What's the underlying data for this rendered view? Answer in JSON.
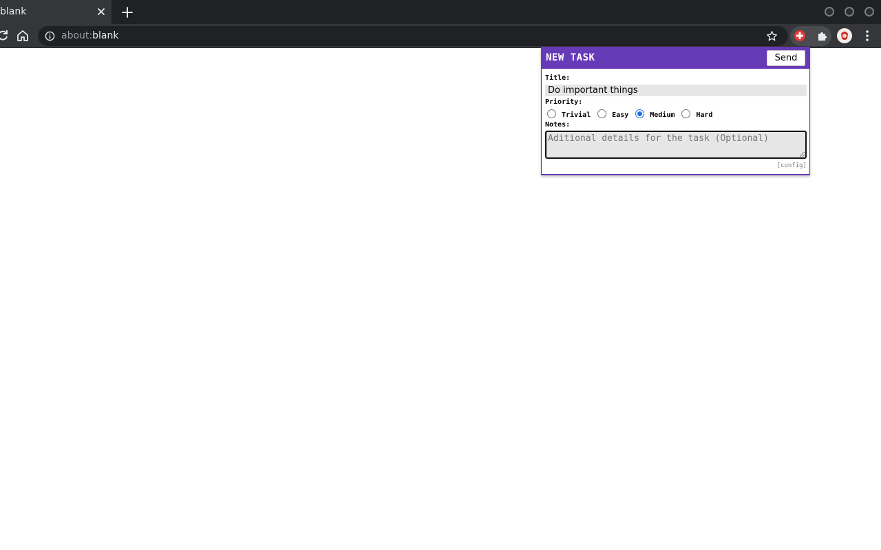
{
  "browser": {
    "tab": {
      "title": "blank",
      "close_icon": "close-icon"
    },
    "new_tab_icon": "plus-icon",
    "window_controls": [
      "minimize",
      "maximize",
      "close"
    ],
    "address_bar": {
      "scheme": "about:",
      "host": "blank",
      "info_icon": "info-icon"
    },
    "toolbar_icons": [
      "reload-icon",
      "home-icon",
      "star-icon",
      "extension-icon",
      "puzzle-icon",
      "avatar",
      "menu-icon"
    ]
  },
  "popup": {
    "header_title": "NEW TASK",
    "send_label": "Send",
    "title_label": "Title:",
    "title_value": "Do important things",
    "priority_label": "Priority:",
    "priorities": [
      {
        "label": "Trivial",
        "checked": false
      },
      {
        "label": "Easy",
        "checked": false
      },
      {
        "label": "Medium",
        "checked": true
      },
      {
        "label": "Hard",
        "checked": false
      }
    ],
    "notes_label": "Notes:",
    "notes_placeholder": "Aditional details for the task (Optional)",
    "config_link": "[config]"
  },
  "colors": {
    "accent": "#673ab7",
    "chrome_dark": "#202124",
    "chrome_mid": "#35363a",
    "radio_checked": "#1a73e8"
  }
}
